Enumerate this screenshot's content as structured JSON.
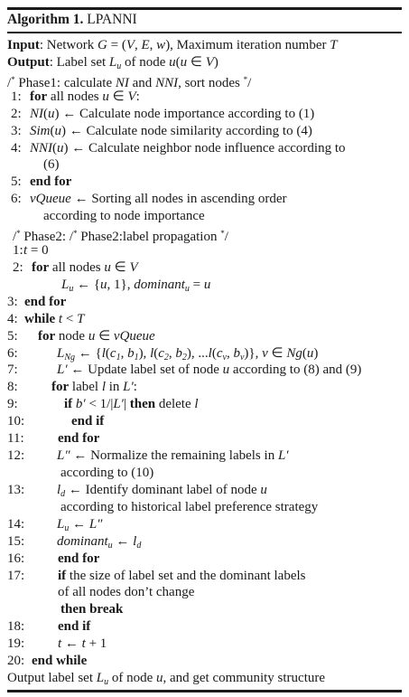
{
  "algorithm": {
    "title_bold": "Algorithm 1.",
    "title_name": "LPANNI",
    "lines": [
      {
        "num": "",
        "seg": [
          [
            "b",
            "Input"
          ],
          [
            "r",
            ": Network "
          ],
          [
            "i",
            "G"
          ],
          [
            "r",
            " = ("
          ],
          [
            "i",
            "V"
          ],
          [
            "r",
            ", "
          ],
          [
            "i",
            "E"
          ],
          [
            "r",
            ", "
          ],
          [
            "i",
            "w"
          ],
          [
            "r",
            "), Maximum iteration number "
          ],
          [
            "i",
            "T"
          ]
        ]
      },
      {
        "num": "",
        "seg": [
          [
            "b",
            "Output"
          ],
          [
            "r",
            ": Label set "
          ],
          [
            "i",
            "L"
          ],
          [
            "sub",
            "u"
          ],
          [
            "r",
            " of node "
          ],
          [
            "i",
            "u"
          ],
          [
            "r",
            "("
          ],
          [
            "i",
            "u"
          ],
          [
            "r",
            " ∈ "
          ],
          [
            "i",
            "V"
          ],
          [
            "r",
            ")"
          ]
        ]
      },
      {
        "num": "",
        "seg": [
          [
            "r",
            "/"
          ],
          [
            "sup",
            "*"
          ],
          [
            "r",
            " Phase1: calculate "
          ],
          [
            "i",
            "NI"
          ],
          [
            "r",
            " and "
          ],
          [
            "i",
            "NNI"
          ],
          [
            "r",
            ", sort nodes "
          ],
          [
            "sup",
            "*"
          ],
          [
            "r",
            "/"
          ]
        ]
      },
      {
        "num": "1:",
        "seg": [
          [
            "b",
            "for"
          ],
          [
            "r",
            " all nodes "
          ],
          [
            "i",
            "u"
          ],
          [
            "r",
            " ∈ "
          ],
          [
            "i",
            "V"
          ],
          [
            "r",
            ":"
          ]
        ]
      },
      {
        "num": "2:",
        "seg": [
          [
            "i",
            "NI"
          ],
          [
            "r",
            "("
          ],
          [
            "i",
            "u"
          ],
          [
            "r",
            ") ← Calculate node importance according to (1)"
          ]
        ]
      },
      {
        "num": "3:",
        "seg": [
          [
            "i",
            "Sim"
          ],
          [
            "r",
            "("
          ],
          [
            "i",
            "u"
          ],
          [
            "r",
            ") ← Calculate node similarity according to (4)"
          ]
        ]
      },
      {
        "num": "4:",
        "seg": [
          [
            "i",
            "NNI"
          ],
          [
            "r",
            "("
          ],
          [
            "i",
            "u"
          ],
          [
            "r",
            ") ← Calculate neighbor node influence according to"
          ]
        ]
      },
      {
        "num": "",
        "seg": [
          [
            "r",
            "(6)"
          ]
        ]
      },
      {
        "num": "5:",
        "seg": [
          [
            "b",
            "end for"
          ]
        ]
      },
      {
        "num": "6:",
        "seg": [
          [
            "i",
            "vQueue"
          ],
          [
            "r",
            " ← Sorting all nodes in ascending order"
          ]
        ]
      },
      {
        "num": "",
        "seg": [
          [
            "r",
            "according to node importance"
          ]
        ]
      },
      {
        "num": "",
        "seg": [
          [
            "r",
            "/"
          ],
          [
            "sup",
            "*"
          ],
          [
            "r",
            " Phase2:  /"
          ],
          [
            "sup",
            "*"
          ],
          [
            "r",
            " Phase2:label propagation "
          ],
          [
            "sup",
            "*"
          ],
          [
            "r",
            "/"
          ]
        ]
      },
      {
        "num": "1:",
        "seg": [
          [
            "i",
            "t"
          ],
          [
            "r",
            " = 0"
          ]
        ]
      },
      {
        "num": "2:",
        "seg": [
          [
            "b",
            "for"
          ],
          [
            "r",
            " all nodes "
          ],
          [
            "i",
            "u"
          ],
          [
            "r",
            " ∈ "
          ],
          [
            "i",
            "V"
          ]
        ]
      },
      {
        "num": "",
        "seg": [
          [
            "i",
            "L"
          ],
          [
            "sub",
            "u"
          ],
          [
            "r",
            " ← {"
          ],
          [
            "i",
            "u"
          ],
          [
            "r",
            ", 1}, "
          ],
          [
            "i",
            "dominant"
          ],
          [
            "sub",
            "u"
          ],
          [
            "r",
            " = "
          ],
          [
            "i",
            "u"
          ]
        ]
      },
      {
        "num": "3:",
        "seg": [
          [
            "b",
            "end for"
          ]
        ]
      },
      {
        "num": "4:",
        "seg": [
          [
            "b",
            "while"
          ],
          [
            "r",
            " "
          ],
          [
            "i",
            "t"
          ],
          [
            "r",
            " < "
          ],
          [
            "i",
            "T"
          ]
        ]
      },
      {
        "num": "5:",
        "seg": [
          [
            "b",
            "for"
          ],
          [
            "r",
            " node "
          ],
          [
            "i",
            "u"
          ],
          [
            "r",
            " ∈ "
          ],
          [
            "i",
            "vQueue"
          ]
        ]
      },
      {
        "num": "6:",
        "seg": [
          [
            "i",
            "L"
          ],
          [
            "sub",
            "Ng"
          ],
          [
            "r",
            " ← {"
          ],
          [
            "i",
            "l"
          ],
          [
            "r",
            "("
          ],
          [
            "i",
            "c"
          ],
          [
            "sub",
            "1"
          ],
          [
            "r",
            ", "
          ],
          [
            "i",
            "b"
          ],
          [
            "sub",
            "1"
          ],
          [
            "r",
            "), "
          ],
          [
            "i",
            "l"
          ],
          [
            "r",
            "("
          ],
          [
            "i",
            "c"
          ],
          [
            "sub",
            "2"
          ],
          [
            "r",
            ", "
          ],
          [
            "i",
            "b"
          ],
          [
            "sub",
            "2"
          ],
          [
            "r",
            "), ..."
          ],
          [
            "i",
            "l"
          ],
          [
            "r",
            "("
          ],
          [
            "i",
            "c"
          ],
          [
            "sub",
            "v"
          ],
          [
            "r",
            ", "
          ],
          [
            "i",
            "b"
          ],
          [
            "sub",
            "v"
          ],
          [
            "r",
            ")}, "
          ],
          [
            "i",
            "v"
          ],
          [
            "r",
            " ∈ "
          ],
          [
            "i",
            "Ng"
          ],
          [
            "r",
            "("
          ],
          [
            "i",
            "u"
          ],
          [
            "r",
            ")"
          ]
        ]
      },
      {
        "num": "7:",
        "seg": [
          [
            "i",
            "L′"
          ],
          [
            "r",
            " ← Update label set of node "
          ],
          [
            "i",
            "u"
          ],
          [
            "r",
            " according to (8) and (9)"
          ]
        ]
      },
      {
        "num": "8:",
        "seg": [
          [
            "b",
            "for"
          ],
          [
            "r",
            " label "
          ],
          [
            "i",
            "l"
          ],
          [
            "r",
            " in "
          ],
          [
            "i",
            "L′"
          ],
          [
            "r",
            ":"
          ]
        ]
      },
      {
        "num": "9:",
        "seg": [
          [
            "b",
            "if"
          ],
          [
            "r",
            " "
          ],
          [
            "i",
            "b′"
          ],
          [
            "r",
            " < 1/|"
          ],
          [
            "i",
            "L′"
          ],
          [
            "r",
            "| "
          ],
          [
            "b",
            "then"
          ],
          [
            "r",
            " delete "
          ],
          [
            "i",
            "l"
          ]
        ]
      },
      {
        "num": "10:",
        "seg": [
          [
            "b",
            "end if"
          ]
        ]
      },
      {
        "num": "11:",
        "seg": [
          [
            "b",
            "end for"
          ]
        ]
      },
      {
        "num": "12:",
        "seg": [
          [
            "i",
            "L″"
          ],
          [
            "r",
            " ← Normalize the remaining labels in "
          ],
          [
            "i",
            "L′"
          ]
        ]
      },
      {
        "num": "",
        "seg": [
          [
            "r",
            "according to (10)"
          ]
        ]
      },
      {
        "num": "13:",
        "seg": [
          [
            "i",
            "l"
          ],
          [
            "sub",
            "d"
          ],
          [
            "r",
            " ← Identify dominant label of node "
          ],
          [
            "i",
            "u"
          ]
        ]
      },
      {
        "num": "",
        "seg": [
          [
            "r",
            "according to historical label preference strategy"
          ]
        ]
      },
      {
        "num": "14:",
        "seg": [
          [
            "i",
            "L"
          ],
          [
            "sub",
            "u"
          ],
          [
            "r",
            " ← "
          ],
          [
            "i",
            "L″"
          ]
        ]
      },
      {
        "num": "15:",
        "seg": [
          [
            "i",
            "dominant"
          ],
          [
            "sub",
            "u"
          ],
          [
            "r",
            " ← "
          ],
          [
            "i",
            "l"
          ],
          [
            "sub",
            "d"
          ]
        ]
      },
      {
        "num": "16:",
        "seg": [
          [
            "b",
            "end for"
          ]
        ]
      },
      {
        "num": "17:",
        "seg": [
          [
            "b",
            "if"
          ],
          [
            "r",
            " the size of label set and the dominant labels"
          ]
        ]
      },
      {
        "num": "",
        "seg": [
          [
            "r",
            "of all nodes don’t change"
          ]
        ]
      },
      {
        "num": "",
        "seg": [
          [
            "b",
            "then break"
          ]
        ]
      },
      {
        "num": "18:",
        "seg": [
          [
            "b",
            "end if"
          ]
        ]
      },
      {
        "num": "19:",
        "seg": [
          [
            "i",
            "t"
          ],
          [
            "r",
            " ← "
          ],
          [
            "i",
            "t"
          ],
          [
            "r",
            " + 1"
          ]
        ]
      },
      {
        "num": "20:",
        "seg": [
          [
            "b",
            "end while"
          ]
        ]
      },
      {
        "num": "",
        "seg": [
          [
            "r",
            "Output label set "
          ],
          [
            "i",
            "L"
          ],
          [
            "sub",
            "u"
          ],
          [
            "r",
            " of node "
          ],
          [
            "i",
            "u"
          ],
          [
            "r",
            ", and get community structure"
          ]
        ]
      }
    ]
  }
}
